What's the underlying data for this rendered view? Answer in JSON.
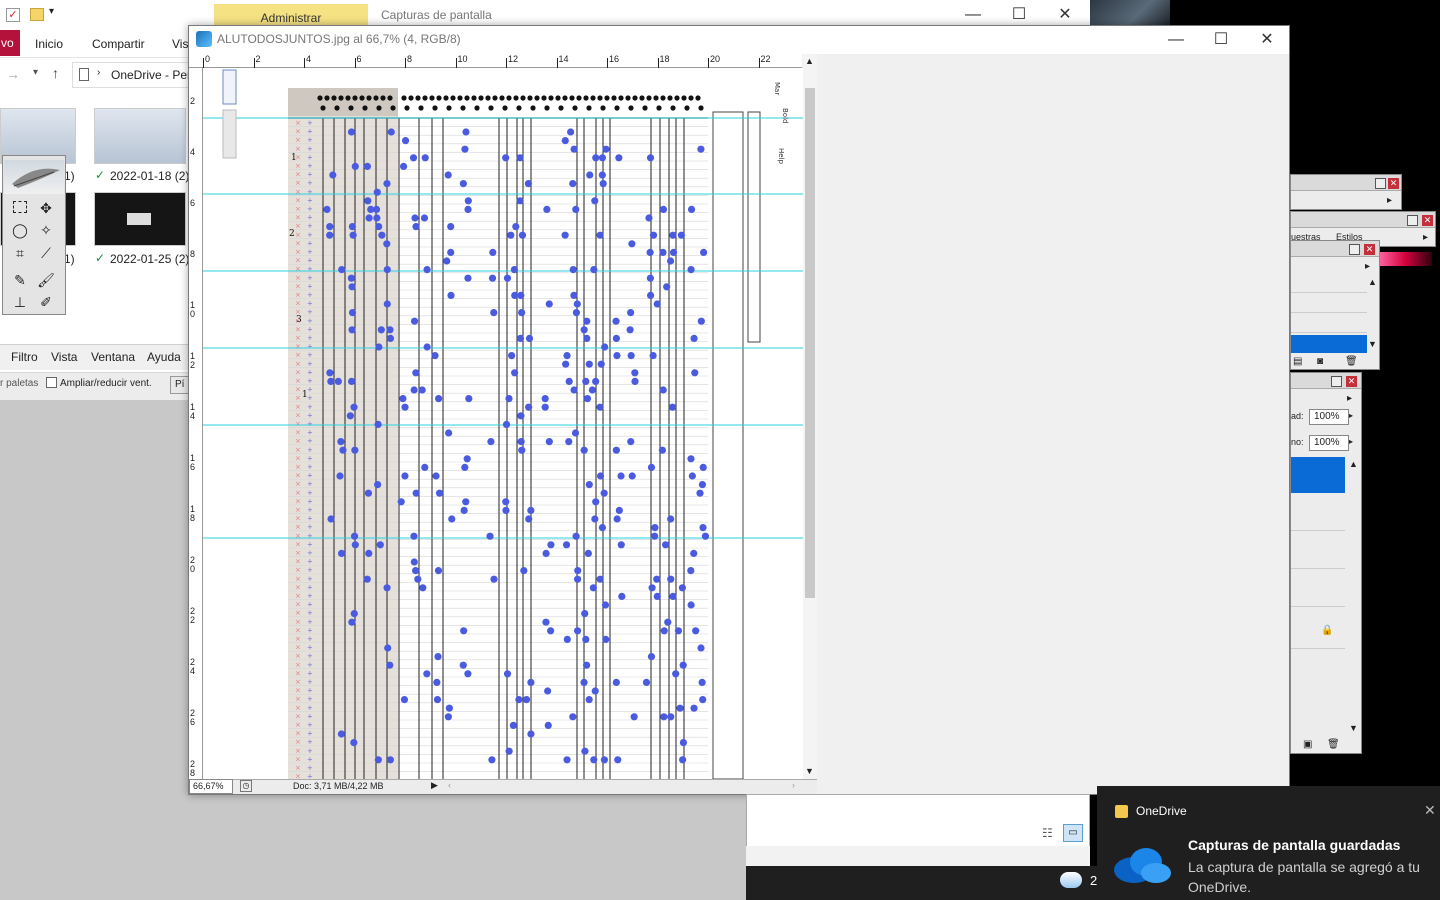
{
  "explorer": {
    "admin_tab": "Administrar",
    "caption": "Capturas de pantalla",
    "ribbon": {
      "file": "vo",
      "home": "Inicio",
      "share": "Compartir",
      "view": "Vis"
    },
    "address": "OneDrive - Per",
    "thumbnails": [
      {
        "label": "1)"
      },
      {
        "label": "2022-01-18 (2)"
      },
      {
        "label": "1)"
      },
      {
        "label": "2022-01-25 (2)"
      }
    ]
  },
  "photoshop": {
    "menu": {
      "filter": "Filtro",
      "view": "Vista",
      "window": "Ventana",
      "help": "Ayuda"
    },
    "options": {
      "palettes": "r paletas",
      "resize": "Ampliar/reducir vent.",
      "button": "Pí"
    },
    "document": {
      "title": "ALUTODOSJUNTOS.jpg al 66,7% (4, RGB/8)",
      "zoom": "66,67%",
      "doc_size": "Doc: 3,71 MB/4,22 MB",
      "ruler_top": [
        "0",
        "2",
        "4",
        "6",
        "8",
        "10",
        "12",
        "14",
        "16",
        "18",
        "20",
        "22"
      ],
      "ruler_left": [
        "2",
        "4",
        "6",
        "8",
        "1 0",
        "1 2",
        "1 4",
        "1 6",
        "1 8",
        "2 0",
        "2 2",
        "2 4",
        "2 6",
        "2 8"
      ],
      "row_markers": [
        "1",
        "2",
        "3",
        "1"
      ],
      "side_labels": [
        "Mar",
        "Bold",
        "Help"
      ]
    },
    "palettes": {
      "tabs": [
        "uestras",
        "Estilos"
      ],
      "opacity_label": "ad:",
      "opacity_value": "100%",
      "fill_label": "no:",
      "fill_value": "100%"
    }
  },
  "taskbar": {
    "number": "2"
  },
  "toast": {
    "app": "OneDrive",
    "title": "Capturas de pantalla guardadas",
    "body": "La captura de pantalla se agregó a tu OneDrive."
  },
  "colors": {
    "dot": "#4a5be0",
    "guide": "#2ad0e0",
    "toast_bg": "#1f1f1f",
    "selection": "#0a6ad6"
  }
}
